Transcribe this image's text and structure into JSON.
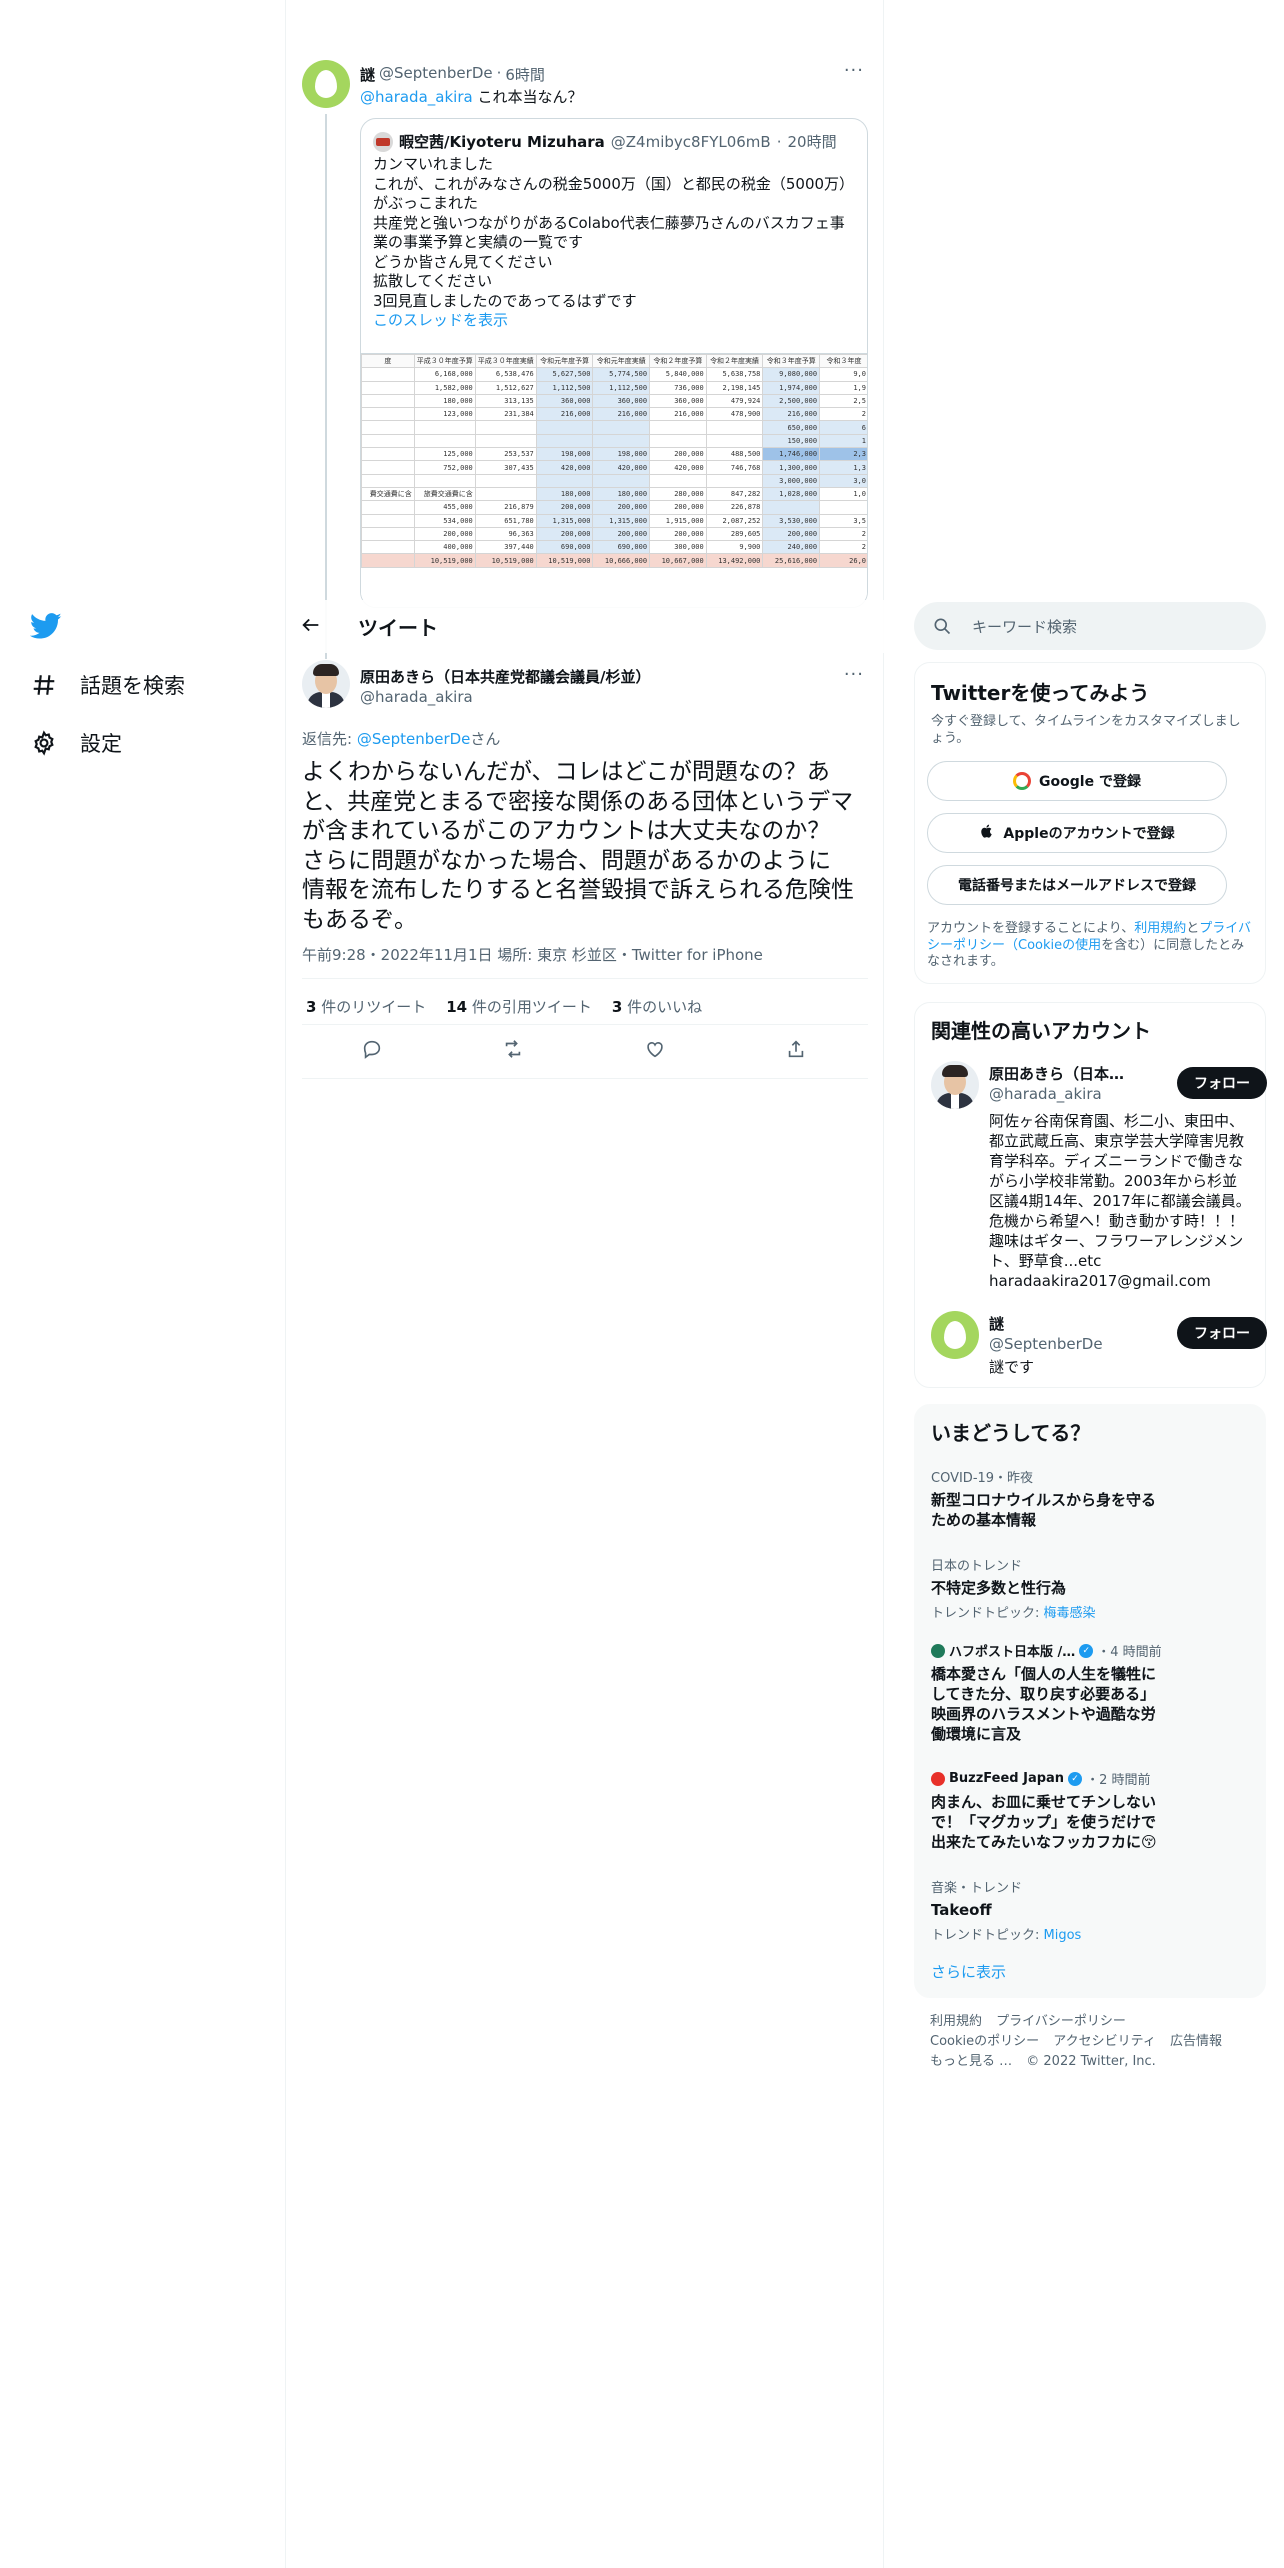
{
  "nav": {
    "explore_label": "話題を検索",
    "settings_label": "設定"
  },
  "parent_tweet": {
    "name": "謎",
    "handle": "@SeptenberDe",
    "time": "6時間",
    "mention": "@harada_akira",
    "text": "これ本当なん？",
    "quote": {
      "name": "暇空茜/Kiyoteru Mizuhara",
      "handle": "@Z4mibyc8FYL06mB",
      "time": "20時間",
      "lines": [
        "カンマいれました",
        "これが、これがみなさんの税金5000万（国）と都民の税金（5000万）",
        "がぶっこまれた",
        "共産党と強いつながりがあるColabo代表仁藤夢乃さんのバスカフェ事",
        "業の事業予算と実績の一覧です",
        "どうか皆さん見てください",
        "拡散してください",
        "3回見直しましたのであってるはずです"
      ],
      "thread_link": "このスレッドを表示"
    },
    "sheet": {
      "headers": [
        "度",
        "平成３０年度予算",
        "平成３０年度実績",
        "令和元年度予算",
        "令和元年度実績",
        "令和２年度予算",
        "令和２年度実績",
        "令和３年度予算",
        "令和３年度"
      ],
      "rows": [
        [
          "",
          "6,168,000",
          "6,538,476",
          "5,627,500",
          "5,774,500",
          "5,840,000",
          "5,638,758",
          "9,080,000",
          "9,0"
        ],
        [
          "",
          "1,582,000",
          "1,512,627",
          "1,112,500",
          "1,112,500",
          "736,000",
          "2,198,145",
          "1,974,000",
          "1,9"
        ],
        [
          "",
          "180,000",
          "313,135",
          "360,000",
          "360,000",
          "360,000",
          "479,924",
          "2,500,000",
          "2,5"
        ],
        [
          "",
          "123,000",
          "231,384",
          "216,000",
          "216,000",
          "216,000",
          "478,900",
          "216,000",
          "2"
        ],
        [
          "",
          "",
          "",
          "",
          "",
          "",
          "",
          "650,000",
          "6"
        ],
        [
          "",
          "",
          "",
          "",
          "",
          "",
          "",
          "150,000",
          "1"
        ],
        [
          "",
          "125,000",
          "253,537",
          "198,000",
          "198,000",
          "200,000",
          "488,500",
          "1,746,000",
          "2,3"
        ],
        [
          "",
          "752,000",
          "307,435",
          "420,000",
          "420,000",
          "420,000",
          "746,768",
          "1,300,000",
          "1,3"
        ],
        [
          "",
          "",
          "",
          "",
          "",
          "",
          "",
          "3,000,000",
          "3,0"
        ],
        [
          "費交通費に含",
          "旅費交通費に含",
          "",
          "180,000",
          "180,000",
          "280,000",
          "847,282",
          "1,028,000",
          "1,0"
        ],
        [
          "",
          "455,000",
          "216,879",
          "200,000",
          "200,000",
          "200,000",
          "226,878",
          "",
          ""
        ],
        [
          "",
          "534,000",
          "651,780",
          "1,315,000",
          "1,315,000",
          "1,915,000",
          "2,087,252",
          "3,530,000",
          "3,5"
        ],
        [
          "",
          "200,000",
          "96,363",
          "200,000",
          "200,000",
          "200,000",
          "289,605",
          "200,000",
          "2"
        ],
        [
          "",
          "400,000",
          "397,440",
          "690,000",
          "690,000",
          "300,000",
          "9,900",
          "240,000",
          "2"
        ],
        [
          "",
          "10,519,000",
          "10,519,000",
          "10,519,000",
          "10,666,000",
          "10,667,000",
          "13,492,000",
          "25,616,000",
          "26,0"
        ]
      ]
    }
  },
  "topbar": {
    "title": "ツイート"
  },
  "focus_tweet": {
    "name": "原田あきら（日本共産党都議会議員/杉並）",
    "handle": "@harada_akira",
    "reply_prefix": "返信先: ",
    "reply_to": "@SeptenberDe",
    "reply_suffix": "さん",
    "text_lines": [
      "よくわからないんだが、コレはどこが問題なの？あ",
      "と、共産党とまるで密接な関係のある団体というデマ",
      "が含まれているがこのアカウントは大丈夫なのか？",
      "さらに問題がなかった場合、問題があるかのように",
      "情報を流布したりすると名誉毀損で訴えられる危険性",
      "もあるぞ。"
    ],
    "meta": "午前9:28・2022年11月1日 場所: 東京 杉並区・Twitter for iPhone",
    "retweets": "3",
    "retweets_label": "件のリツイート",
    "quotes": "14",
    "quotes_label": "件の引用ツイート",
    "likes": "3",
    "likes_label": "件のいいね"
  },
  "search": {
    "placeholder": "キーワード検索"
  },
  "signup": {
    "title": "Twitterを使ってみよう",
    "subtitle": "今すぐ登録して、タイムラインをカスタマイズしましょう。",
    "google": "Google で登録",
    "apple": "Appleのアカウントで登録",
    "phone": "電話番号またはメールアドレスで登録",
    "terms_a": "アカウントを登録することにより、",
    "terms_link1": "利用規約",
    "terms_b": "と",
    "terms_link2": "プライバシーポリシー（Cookieの使用",
    "terms_c": "を含む）に同意したとみなされます。"
  },
  "related": {
    "title": "関連性の高いアカウント",
    "follow_label": "フォロー",
    "accounts": [
      {
        "name": "原田あきら（日本共産党都議会議員/杉並）",
        "handle": "@harada_akira",
        "bio_lines": [
          "阿佐ヶ谷南保育園、杉二小、東田中、",
          "都立武蔵丘高、東京学芸大学障害児教",
          "育学科卒。ディズニーランドで働きな",
          "がら小学校非常勤。2003年から杉並",
          "区議4期14年、2017年に都議会議員。",
          "危機から希望へ！動き動かす時！！！",
          "趣味はギター、フラワーアレンジメン",
          "ト、野草食...etc",
          "haradaakira2017@gmail.com"
        ]
      },
      {
        "name": "謎",
        "handle": "@SeptenberDe",
        "bio_lines": [
          "謎です"
        ]
      }
    ]
  },
  "trends": {
    "title": "いまどうしてる？",
    "items": [
      {
        "cat": "COVID-19・昨夜",
        "title_lines": [
          "新型コロナウイルスから身を守る",
          "ための基本情報"
        ],
        "sub": "",
        "sub_link": ""
      },
      {
        "cat": "日本のトレンド",
        "title_lines": [
          "不特定多数と性行為"
        ],
        "sub": "トレンドトピック: ",
        "sub_link": "梅毒感染"
      },
      {
        "cat": "ハフポスト日本版 /…",
        "cat_time": "・4 時間前",
        "title_lines": [
          "橋本愛さん「個人の人生を犠牲に",
          "してきた分、取り戻す必要ある」",
          "映画界のハラスメントや過酷な労",
          "働環境に言及"
        ],
        "sub": "",
        "sub_link": ""
      },
      {
        "cat": "BuzzFeed Japan",
        "cat_time": "・2 時間前",
        "title_lines": [
          "肉まん、お皿に乗せてチンしない",
          "で！「マグカップ」を使うだけで",
          "出来たてみたいなフッカフカに😚"
        ],
        "sub": "",
        "sub_link": ""
      },
      {
        "cat": "音楽・トレンド",
        "title_lines": [
          "Takeoff"
        ],
        "sub": "トレンドトピック: ",
        "sub_link": "Migos"
      }
    ],
    "show_more": "さらに表示"
  },
  "footer": {
    "links": [
      "利用規約",
      "プライバシーポリシー",
      "Cookieのポリシー",
      "アクセシビリティ",
      "広告情報",
      "もっと見る …"
    ],
    "copyright": "© 2022 Twitter, Inc."
  },
  "colors": {
    "accent": "#1d9bf0",
    "text": "#0f1419",
    "muted": "#536471",
    "border": "#eff3f4"
  }
}
